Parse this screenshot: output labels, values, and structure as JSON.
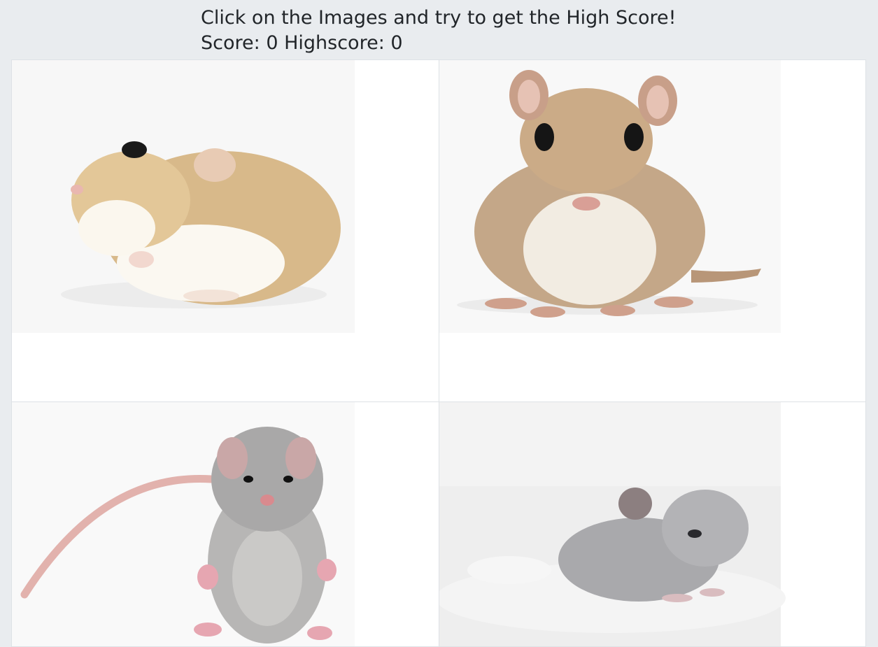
{
  "header": {
    "instructions": "Click on the Images and try to get the High Score!",
    "score_label": "Score:",
    "score": "0",
    "highscore_label": "Highscore:",
    "highscore": "0"
  },
  "cards": [
    {
      "animal": "hamster",
      "icon": "hamster-image"
    },
    {
      "animal": "gerbil",
      "icon": "gerbil-image"
    },
    {
      "animal": "mouse",
      "icon": "mouse-image"
    },
    {
      "animal": "chinchilla",
      "icon": "chinchilla-image"
    }
  ]
}
